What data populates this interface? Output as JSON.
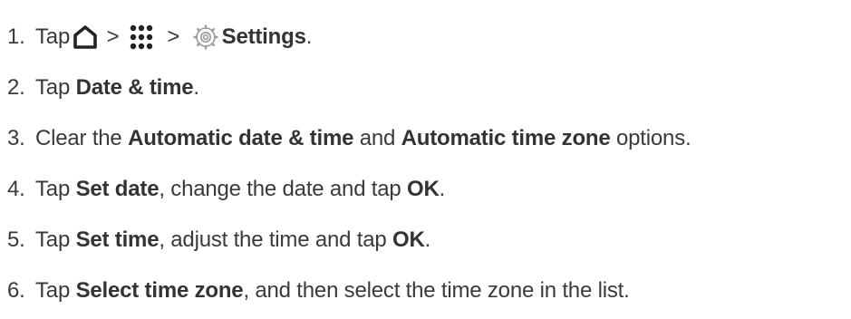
{
  "steps": [
    {
      "number": "1.",
      "parts": {
        "p1": "Tap",
        "sep1": " > ",
        "sep2": " > ",
        "bold1": "Settings",
        "end": "."
      },
      "icons": [
        "home-icon",
        "apps-grid-icon",
        "settings-gear-icon"
      ]
    },
    {
      "number": "2.",
      "parts": {
        "p1": "Tap ",
        "bold1": "Date & time",
        "end": "."
      }
    },
    {
      "number": "3.",
      "parts": {
        "p1": "Clear the ",
        "bold1": "Automatic date & time",
        "p2": " and ",
        "bold2": "Automatic time zone",
        "end": " options."
      }
    },
    {
      "number": "4.",
      "parts": {
        "p1": "Tap ",
        "bold1": "Set date",
        "p2": ", change the date and tap ",
        "bold2": "OK",
        "end": "."
      }
    },
    {
      "number": "5.",
      "parts": {
        "p1": "Tap ",
        "bold1": "Set time",
        "p2": ", adjust the time and tap ",
        "bold2": "OK",
        "end": "."
      }
    },
    {
      "number": "6.",
      "parts": {
        "p1": "Tap ",
        "bold1": "Select time zone",
        "end": ", and then select the time zone in the list."
      }
    }
  ],
  "colors": {
    "text": "#3a3a3a",
    "icon": "#222222",
    "gear": "#9a9a9a"
  }
}
